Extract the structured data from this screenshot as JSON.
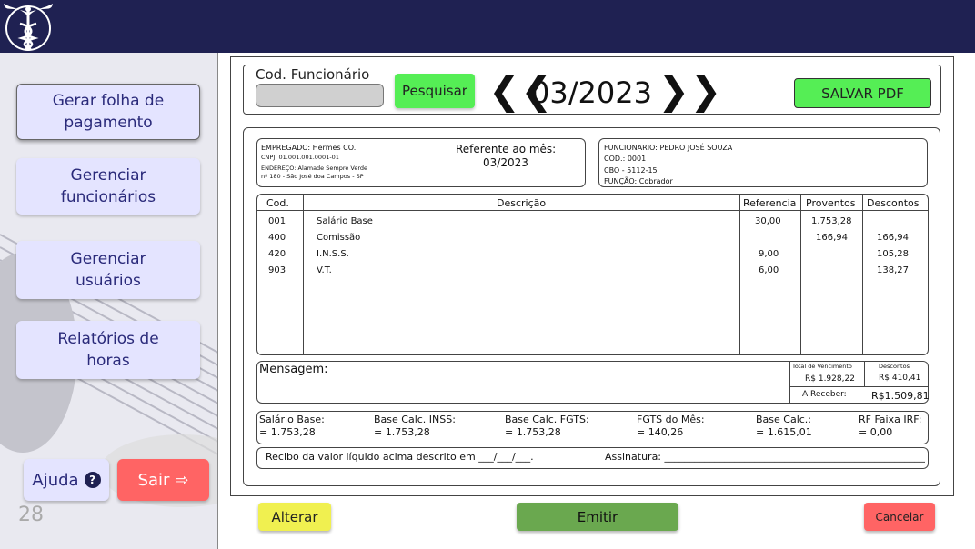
{
  "header": {
    "logo_icon": "caduceus-icon"
  },
  "sidebar": {
    "items": [
      {
        "label_line1": "Gerar folha de",
        "label_line2": "pagamento"
      },
      {
        "label_line1": "Gerenciar",
        "label_line2": "funcionários"
      },
      {
        "label_line1": "Gerenciar",
        "label_line2": "usuários"
      },
      {
        "label_line1": "Relatórios de",
        "label_line2": "horas"
      }
    ],
    "help_label": "Ajuda",
    "help_icon": "?",
    "exit_label": "Sair",
    "exit_icon": "⇨"
  },
  "search": {
    "code_label": "Cod. Funcionário",
    "code_value": "",
    "search_label": "Pesquisar",
    "month": "03/2023",
    "prev_icon": "❮❮",
    "next_icon": "❯❯",
    "save_pdf_label": "SALVAR PDF"
  },
  "employer": {
    "name": "EMPREGADO: Hermes CO.",
    "cnpj": "CNPJ: 01.001.001.0001-01",
    "address": "ENDEREÇO: Alamade Sempre Verde",
    "address2": "nº 180 - São José doa Campos - SP"
  },
  "reference": {
    "label": "Referente ao mês:",
    "value": "03/2023"
  },
  "employee": {
    "name": "FUNCIONARIO: PEDRO JOSÉ SOUZA",
    "code": "COD.: 0001",
    "cbo": "CBO - 5112-15",
    "function": "FUNÇÃO: Cobrador"
  },
  "table": {
    "headers": {
      "cod": "Cod.",
      "desc": "Descrição",
      "ref": "Referencia",
      "prov": "Proventos",
      "desc_val": "Descontos"
    },
    "rows": [
      {
        "cod": "001",
        "desc": "Salário Base",
        "ref": "30,00",
        "prov": "1.753,28",
        "disc": ""
      },
      {
        "cod": "400",
        "desc": "Comissão",
        "ref": "",
        "prov": "166,94",
        "disc": "166,94"
      },
      {
        "cod": "420",
        "desc": "I.N.S.S.",
        "ref": "9,00",
        "prov": "",
        "disc": "105,28"
      },
      {
        "cod": "903",
        "desc": "V.T.",
        "ref": "6,00",
        "prov": "",
        "disc": "138,27"
      }
    ]
  },
  "message": {
    "label": "Mensagem:"
  },
  "totals": {
    "venc_label": "Total de Vencimento",
    "venc_value": "R$ 1.928,22",
    "desc_label": "Descontos",
    "desc_value": "R$ 410,41",
    "receive_label": "A Receber:",
    "receive_value": "R$1.509,81"
  },
  "bases": [
    {
      "label": "Salário Base:",
      "value": "= 1.753,28"
    },
    {
      "label": "Base Calc. INSS:",
      "value": "= 1.753,28"
    },
    {
      "label": "Base Calc. FGTS:",
      "value": "= 1.753,28"
    },
    {
      "label": "FGTS do Mês:",
      "value": "= 140,26"
    },
    {
      "label": "Base Calc.:",
      "value": "= 1.615,01"
    },
    {
      "label": "RF Faixa IRF:",
      "value": "= 0,00"
    }
  ],
  "receipt": {
    "text": "Recibo da valor líquido acima descrito em ___/___/___.",
    "signature": "Assinatura: ______________________________________________________________________."
  },
  "actions": {
    "alter_label": "Alterar",
    "emit_label": "Emitir",
    "cancel_label": "Cancelar"
  },
  "colors": {
    "topbar": "#1f2152",
    "green": "#55ee55",
    "emit": "#6aa84f",
    "yellow": "#f0f050",
    "red": "#ff6464"
  }
}
